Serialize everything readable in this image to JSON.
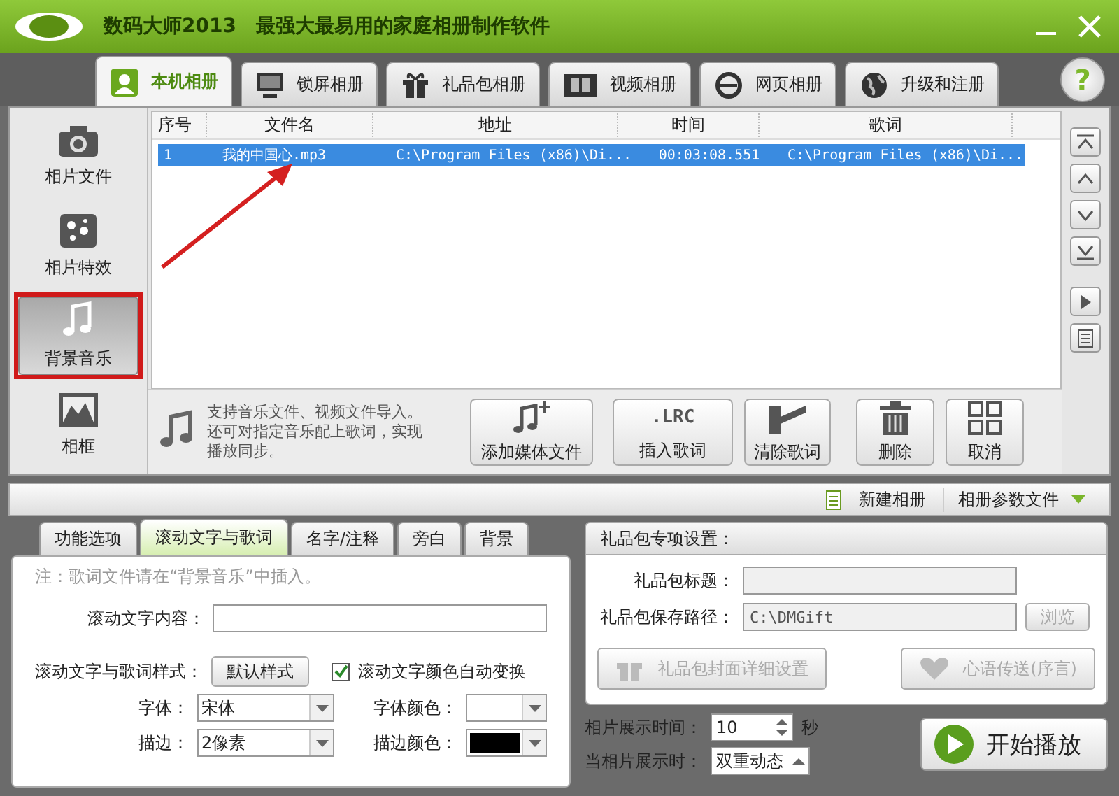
{
  "window": {
    "app_name": "数码大师2013",
    "slogan": "最强大最易用的家庭相册制作软件"
  },
  "tabs": [
    {
      "label": "本机相册",
      "selected": true
    },
    {
      "label": "锁屏相册",
      "selected": false
    },
    {
      "label": "礼品包相册",
      "selected": false
    },
    {
      "label": "视频相册",
      "selected": false
    },
    {
      "label": "网页相册",
      "selected": false
    },
    {
      "label": "升级和注册",
      "selected": false
    }
  ],
  "help": "?",
  "sidebar": {
    "items": [
      {
        "label": "相片文件",
        "selected": false,
        "highlighted": false
      },
      {
        "label": "相片特效",
        "selected": false,
        "highlighted": false
      },
      {
        "label": "背景音乐",
        "selected": true,
        "highlighted": true
      },
      {
        "label": "相框",
        "selected": false,
        "highlighted": false
      }
    ]
  },
  "table": {
    "columns": [
      "序号",
      "文件名",
      "地址",
      "时间",
      "歌词"
    ],
    "rows": [
      {
        "cells": [
          "1",
          "我的中国心.mp3",
          "C:\\Program Files (x86)\\Di...",
          "00:03:08.551",
          "C:\\Program Files (x86)\\Di..."
        ],
        "selected": true
      }
    ]
  },
  "hint": {
    "lines": [
      "支持音乐文件、视频文件导入。",
      "还可对指定音乐配上歌词，实现",
      "播放同步。"
    ]
  },
  "toolbar": [
    {
      "label": "添加媒体文件"
    },
    {
      "label": "插入歌词",
      "icon_text": ".LRC"
    },
    {
      "label": "清除歌词"
    },
    {
      "label": "删除"
    },
    {
      "label": "取消"
    }
  ],
  "album_bar": {
    "new_album": "新建相册",
    "params": "相册参数文件"
  },
  "options": {
    "tabs": [
      {
        "label": "功能选项",
        "selected": false
      },
      {
        "label": "滚动文字与歌词",
        "selected": true
      },
      {
        "label": "名字/注释",
        "selected": false
      },
      {
        "label": "旁白",
        "selected": false
      },
      {
        "label": "背景",
        "selected": false
      }
    ],
    "note": "注：歌词文件请在“背景音乐”中插入。",
    "scroll_text_label": "滚动文字内容：",
    "style_label": "滚动文字与歌词样式：",
    "style_button": "默认样式",
    "auto_color": {
      "label": "滚动文字颜色自动变换",
      "checked": true
    },
    "font_label": "字体：",
    "font": "宋体",
    "font_color_label": "字体颜色：",
    "stroke_label": "描边：",
    "stroke": "2像素",
    "stroke_color_label": "描边颜色："
  },
  "gift": {
    "title": "礼品包专项设置：",
    "title_label": "礼品包标题：",
    "path_label": "礼品包保存路径：",
    "path": "C:\\DMGift",
    "browse": "浏览",
    "cover_button": "礼品包封面详细设置",
    "message_button": "心语传送(序言)"
  },
  "display_time_label": "相片展示时间：",
  "display_time": "10",
  "unit": "秒",
  "display_mode_label": "当相片展示时：",
  "display_mode": "双重动态",
  "start_button": "开始播放"
}
